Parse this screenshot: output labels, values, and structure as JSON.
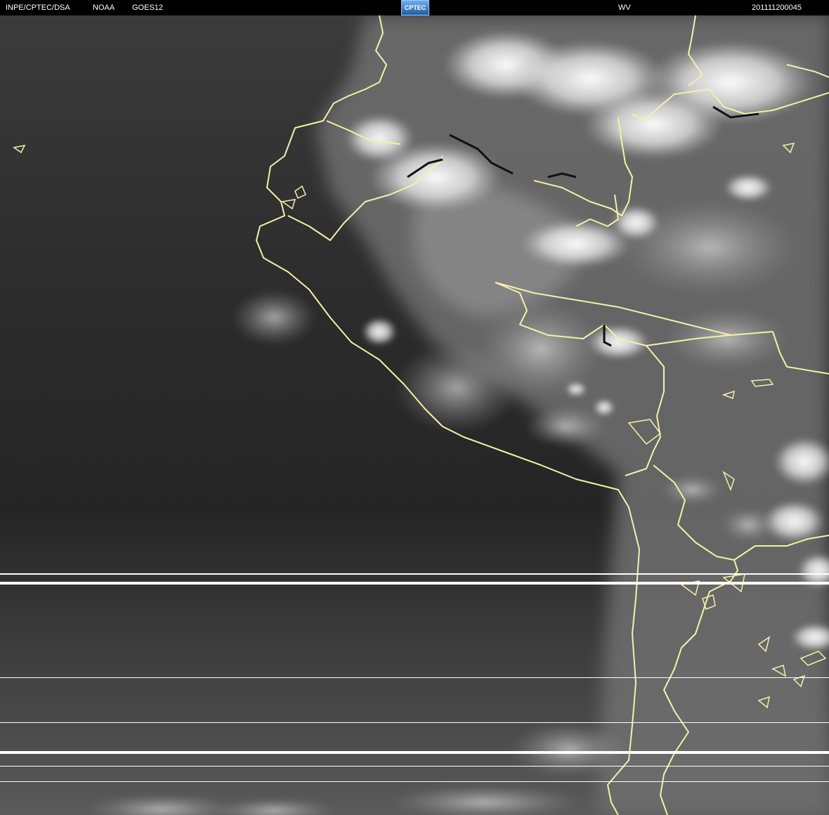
{
  "header": {
    "agency": "INPE/CPTEC/DSA",
    "source": "NOAA",
    "satellite": "GOES12",
    "logo_text": "CPTEC",
    "channel": "WV",
    "timestamp": "201111200045"
  },
  "colors": {
    "coastline": "#f5f0a8",
    "header_bg": "#000000",
    "header_text": "#ffffff",
    "logo": "#3f86d0"
  }
}
